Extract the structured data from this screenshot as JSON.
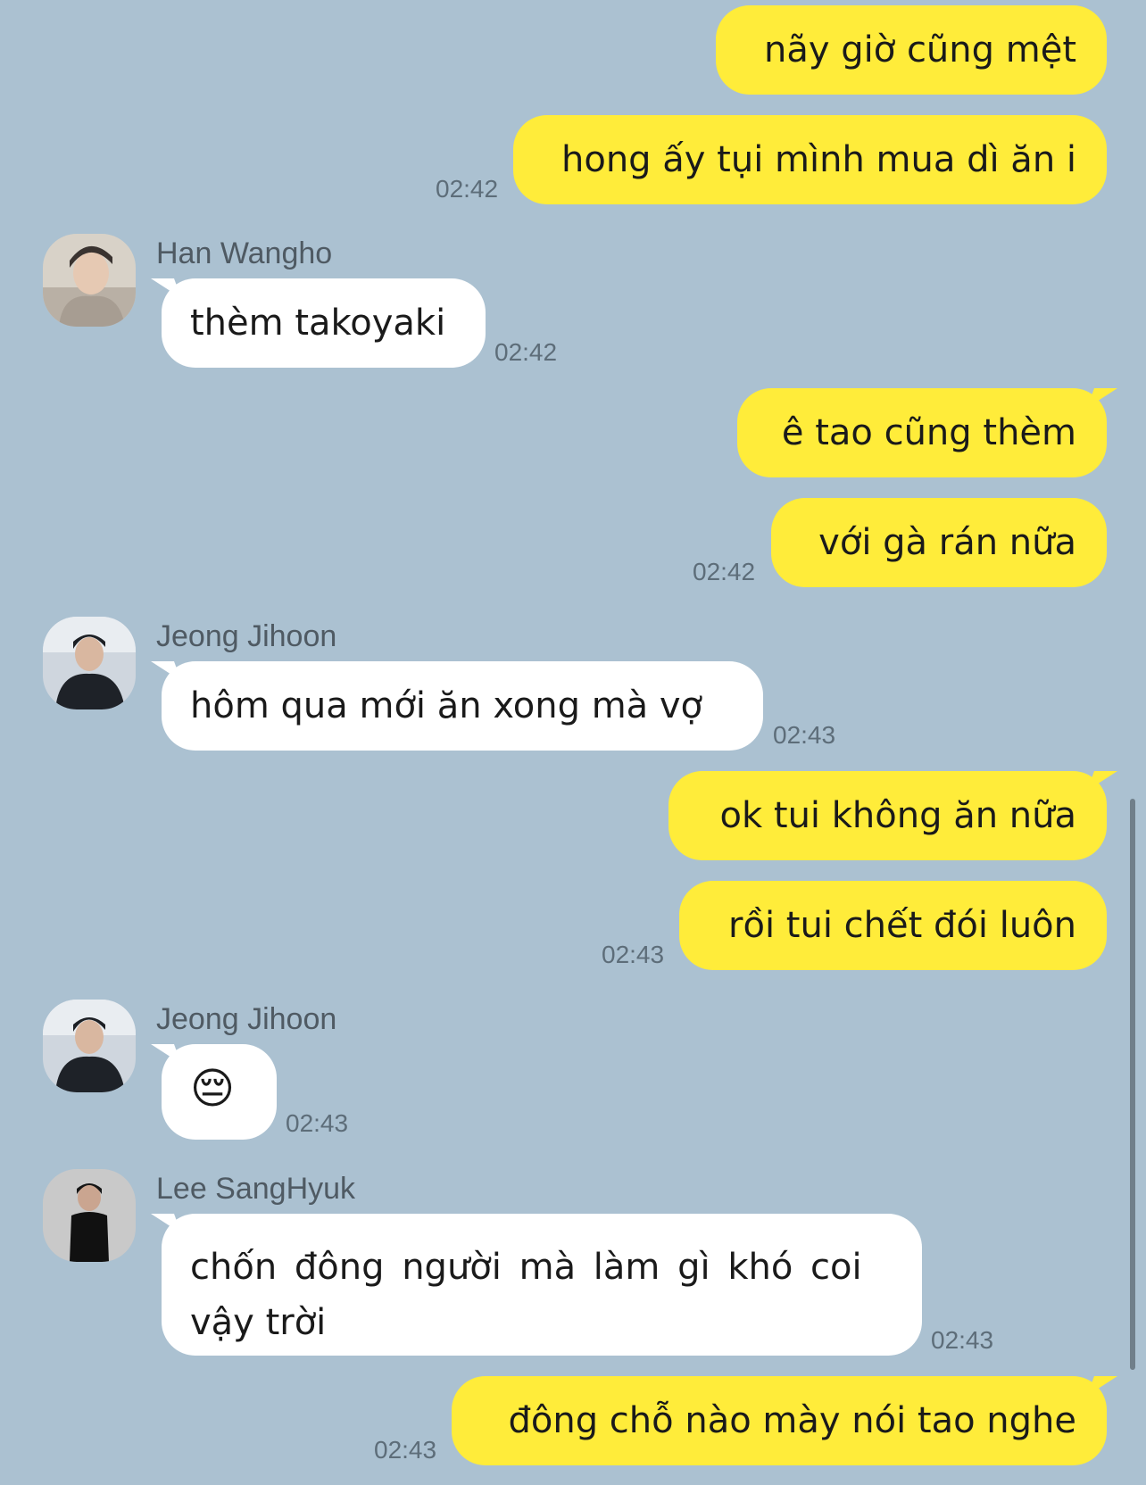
{
  "colors": {
    "background": "#abc1d1",
    "outgoing": "#ffec3a",
    "incoming": "#ffffff"
  },
  "messages": [
    {
      "side": "me",
      "text": "nãy giờ cũng mệt"
    },
    {
      "side": "me",
      "text": "hong ấy tụi mình mua dì ăn i",
      "time": "02:42"
    },
    {
      "side": "them",
      "sender": "Han Wangho",
      "text": "thèm takoyaki",
      "time": "02:42"
    },
    {
      "side": "me",
      "text": "ê tao cũng thèm"
    },
    {
      "side": "me",
      "text": "với gà rán nữa",
      "time": "02:42"
    },
    {
      "side": "them",
      "sender": "Jeong Jihoon",
      "text": "hôm qua mới ăn xong mà vợ",
      "time": "02:43"
    },
    {
      "side": "me",
      "text": "ok tui không ăn nữa"
    },
    {
      "side": "me",
      "text": "rồi tui chết đói luôn",
      "time": "02:43"
    },
    {
      "side": "them",
      "sender": "Jeong Jihoon",
      "text": "😔",
      "time": "02:43"
    },
    {
      "side": "them",
      "sender": "Lee SangHyuk",
      "text_line1": "chốn đông người mà làm gì khó coi",
      "text_line2": "vậy trời",
      "time": "02:43"
    },
    {
      "side": "me",
      "text": "đông chỗ nào mày nói tao nghe",
      "time": "02:43"
    }
  ]
}
